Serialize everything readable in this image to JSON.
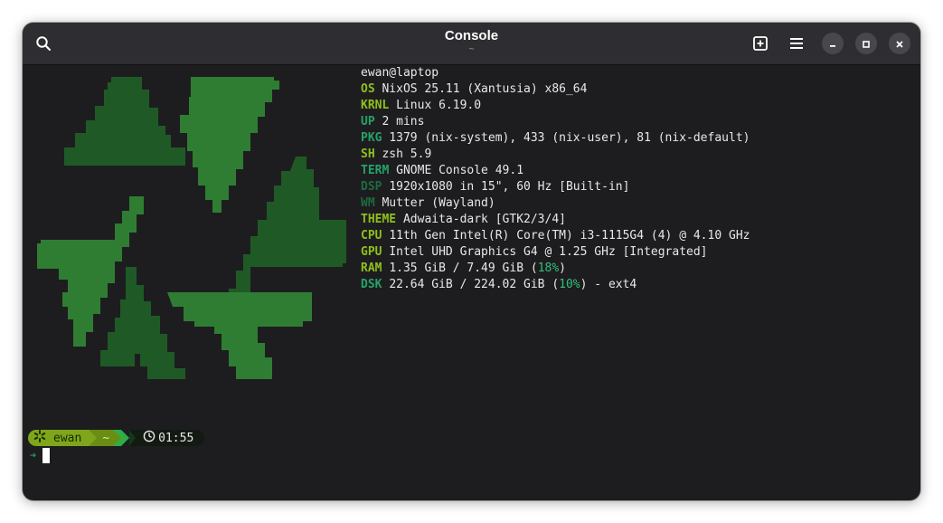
{
  "window": {
    "title": "Console",
    "subtitle": "~"
  },
  "headerbar": {
    "icons": [
      "search-icon",
      "new-tab-icon",
      "hamburger-menu-icon",
      "minimize-icon",
      "maximize-icon",
      "close-icon"
    ]
  },
  "colors": {
    "accent_lime": "#8fbf1c",
    "accent_green": "#26a269",
    "dim_green": "#1e6b3e",
    "terminal_bg": "#1d1d20",
    "logo_light": "#2f7d32",
    "logo_dark": "#1f5a26"
  },
  "fastfetch": {
    "user_host": "ewan@laptop",
    "rows": [
      {
        "key": "OS",
        "value": "NixOS 25.11 (Xantusia) x86_64",
        "color": "lime"
      },
      {
        "key": "KRNL",
        "value": "Linux 6.19.0",
        "color": "lime"
      },
      {
        "key": "UP",
        "value": "2 mins",
        "color": "green"
      },
      {
        "key": "PKG",
        "value": "1379 (nix-system), 433 (nix-user), 81 (nix-default)",
        "color": "green"
      },
      {
        "key": "SH",
        "value": "zsh 5.9",
        "color": "lime"
      },
      {
        "key": "TERM",
        "value": "GNOME Console 49.1",
        "color": "green"
      },
      {
        "key": "DSP",
        "value": "1920x1080 in 15\", 60 Hz [Built-in]",
        "color": "dim"
      },
      {
        "key": "WM",
        "value": "Mutter (Wayland)",
        "color": "dim"
      },
      {
        "key": "THEME",
        "value": "Adwaita-dark [GTK2/3/4]",
        "color": "lime"
      },
      {
        "key": "CPU",
        "value": "11th Gen Intel(R) Core(TM) i3-1115G4 (4) @ 4.10 GHz",
        "color": "lime"
      },
      {
        "key": "GPU",
        "value": "Intel UHD Graphics G4 @ 1.25 GHz [Integrated]",
        "color": "lime"
      }
    ],
    "ram": {
      "key": "RAM",
      "value_pre": "1.35 GiB / 7.49 GiB (",
      "pct": "18%",
      "value_post": ")"
    },
    "dsk": {
      "key": "DSK",
      "value_pre": "22.64 GiB / 224.02 GiB (",
      "pct": "10%",
      "value_post": ") - ext4"
    }
  },
  "prompt": {
    "icon": "nix-snowflake-icon",
    "user": "ewan",
    "dir": "~",
    "clock_icon": "clock-icon",
    "time": "01:55",
    "input_arrow": "➔"
  }
}
